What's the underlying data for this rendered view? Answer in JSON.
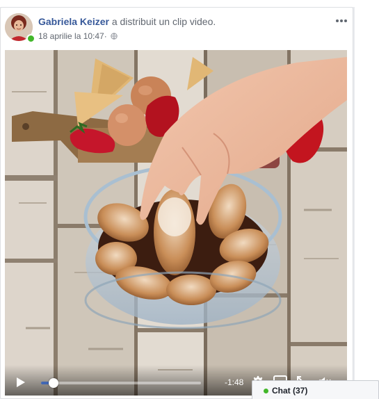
{
  "post": {
    "author_name": "Gabriela Keizer",
    "action_text": " a distribuit un clip video.",
    "timestamp": "18 aprilie la 10:47",
    "separator": " · ",
    "privacy_icon": "globe-icon",
    "more_icon": "more-options-icon"
  },
  "video": {
    "time_remaining": "-1:48",
    "progress_fraction": 0.08,
    "controls": {
      "play_icon": "play-icon",
      "settings_icon": "gear-icon",
      "pip_icon": "picture-in-picture-icon",
      "fullscreen_icon": "fullscreen-icon",
      "mute_icon": "volume-muted-icon"
    }
  },
  "chat": {
    "label": "Chat (37)",
    "status_color": "#42b72a"
  },
  "colors": {
    "author_link": "#365899",
    "progress_fill": "#4267b2",
    "online": "#42b72a"
  }
}
